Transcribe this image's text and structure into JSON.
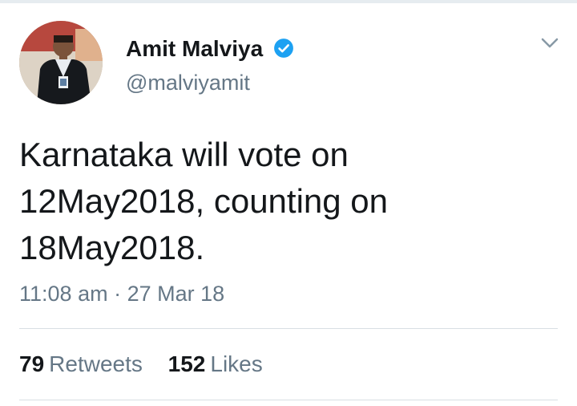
{
  "tweet": {
    "author": {
      "name": "Amit Malviya",
      "handle": "@malviyamit",
      "verified": true
    },
    "text": "Karnataka will vote on\n12May2018, counting on\n18May2018.",
    "time": "11:08 am",
    "separator": "·",
    "date": "27 Mar 18",
    "stats": {
      "retweets_count": "79",
      "retweets_label": "Retweets",
      "likes_count": "152",
      "likes_label": "Likes"
    }
  },
  "icons": {
    "verified": "verified-badge-icon",
    "menu": "chevron-down-icon"
  },
  "colors": {
    "text": "#14171a",
    "secondary": "#657786",
    "verified": "#1da1f2",
    "divider": "#d8dee3"
  }
}
